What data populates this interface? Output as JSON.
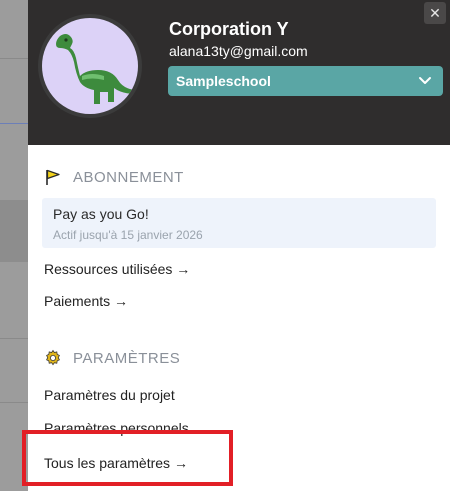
{
  "header": {
    "org_name": "Corporation Y",
    "email": "alana13ty@gmail.com",
    "close_symbol": "✕",
    "org_select": {
      "value": "Sampleschool"
    }
  },
  "subscription": {
    "title": "ABONNEMENT",
    "plan_name": "Pay as you Go!",
    "plan_sub": "Actif jusqu'à 15 janvier 2026",
    "links": [
      "Ressources utilisées →",
      "Paiements →"
    ]
  },
  "settings": {
    "title": "PARAMÈTRES",
    "links": [
      "Paramètres du projet",
      "Paramètres personnels",
      "Tous les paramètres →"
    ]
  },
  "colors": {
    "header_bg": "#2f2d2d",
    "select_bg": "#5aa6a5",
    "plan_bg": "#eef3fb",
    "highlight": "#e21f26",
    "flag": "#f2d21b",
    "gear": "#e0b51a"
  },
  "icons": [
    "dinosaur-avatar",
    "flag-icon",
    "gear-icon",
    "chevron-down-icon",
    "close-icon"
  ]
}
